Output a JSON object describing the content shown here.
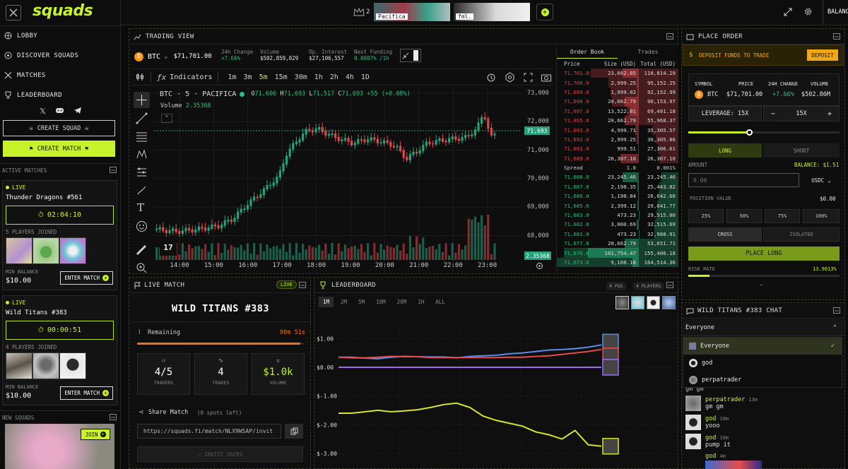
{
  "app": {
    "logo": "squads",
    "squad_count": "2",
    "balance_label": "BALANCE"
  },
  "topbar": {
    "thumbs": [
      {
        "label": "Pacifica"
      },
      {
        "label": "fml."
      }
    ]
  },
  "sidebar": {
    "nav": [
      {
        "label": "LOBBY",
        "icon": "globe-icon"
      },
      {
        "label": "DISCOVER SQUADS",
        "icon": "discover-icon"
      },
      {
        "label": "MATCHES",
        "icon": "swords-icon"
      },
      {
        "label": "LEADERBOARD",
        "icon": "trophy-icon"
      }
    ],
    "create_squad": "CREATE SQUAD",
    "create_match": "CREATE MATCH",
    "active_matches_title": "ACTIVE MATCHES",
    "matches": [
      {
        "status": "LIVE",
        "name": "Thunder Dragons #561",
        "timer": "02:04:10",
        "players": "5 PLAYERS JOINED",
        "min_balance_label": "MIN BALANCE",
        "min_balance": "$10.00",
        "enter": "ENTER MATCH"
      },
      {
        "status": "LIVE",
        "name": "Wild Titans #383",
        "timer": "00:00:51",
        "players": "4 PLAYERS JOINED",
        "min_balance_label": "MIN BALANCE",
        "min_balance": "$10.00",
        "enter": "ENTER MATCH"
      }
    ],
    "new_squads_title": "NEW SQUADS",
    "join": "JOIN"
  },
  "trading": {
    "title": "TRADING VIEW",
    "symbol": "BTC",
    "price": "$71,701.00",
    "stats": [
      {
        "label": "24h Change",
        "value": "+7.66%"
      },
      {
        "label": "Volume",
        "value": "$502,859,029"
      },
      {
        "label": "Op. Interest",
        "value": "$27,106,557"
      },
      {
        "label": "Next Funding",
        "value": "0.0007% /1h"
      }
    ],
    "indicators": "Indicators",
    "timeframes": [
      "1m",
      "3m",
      "5m",
      "15m",
      "30m",
      "1h",
      "2h",
      "4h",
      "1D"
    ],
    "active_tf": "5m",
    "legend": {
      "title": "BTC · 5 · PACIFICA",
      "o_label": "O",
      "o": "71,606",
      "h_label": "H",
      "h": "71,693",
      "l_label": "L",
      "l": "71,517",
      "c_label": "C",
      "c": "71,693",
      "chg": "+55 (+0.08%)",
      "volume_label": "Volume",
      "volume": "2.35368"
    },
    "price_axis": [
      "73,000",
      "72,000",
      "71,000",
      "70,000",
      "69,000",
      "68,000"
    ],
    "last_price": "71,693",
    "last_volume": "2.35368",
    "time_axis": [
      "14:00",
      "15:00",
      "16:00",
      "17:00",
      "18:00",
      "19:00",
      "20:00",
      "21:00",
      "22:00",
      "23:00"
    ]
  },
  "orderbook": {
    "tabs": [
      "Order Book",
      "Trades"
    ],
    "headers": [
      "Price",
      "Size (USD)",
      "Total (USD)"
    ],
    "asks": [
      [
        "71,701.0",
        "23,662.05",
        "118,814.29"
      ],
      [
        "71,700.0",
        "2,999.25",
        "95,152.25"
      ],
      [
        "71,699.0",
        "1,999.02",
        "92,152.99"
      ],
      [
        "71,698.0",
        "20,662.79",
        "90,153.97"
      ],
      [
        "71,697.0",
        "13,522.81",
        "69,491.18"
      ],
      [
        "71,695.0",
        "20,662.79",
        "55,968.37"
      ],
      [
        "71,693.0",
        "4,999.71",
        "35,305.57"
      ],
      [
        "71,692.0",
        "2,999.25",
        "30,305.86"
      ],
      [
        "71,691.0",
        "999.51",
        "27,306.61"
      ],
      [
        "71,689.0",
        "26,307.10",
        "26,307.10"
      ]
    ],
    "spread": [
      "Spread",
      "1.0",
      "0.001%"
    ],
    "bids": [
      [
        "71,688.0",
        "23,245.46",
        "23,245.46"
      ],
      [
        "71,687.0",
        "2,198.35",
        "25,443.82"
      ],
      [
        "71,686.0",
        "1,198.84",
        "26,642.66"
      ],
      [
        "71,685.0",
        "2,399.12",
        "29,041.77"
      ],
      [
        "71,683.0",
        "473.23",
        "29,515.00"
      ],
      [
        "71,682.0",
        "3,000.69",
        "32,515.69"
      ],
      [
        "71,681.0",
        "473.23",
        "32,988.91"
      ],
      [
        "71,677.0",
        "20,662.79",
        "53,651.71"
      ],
      [
        "71,676.0",
        "101,754.47",
        "155,406.18"
      ],
      [
        "71,673.0",
        "9,108.18",
        "164,514.36"
      ]
    ]
  },
  "order": {
    "title": "PLACE ORDER",
    "deposit_text": "DEPOSIT FUNDS TO TRADE",
    "deposit_btn": "DEPOSIT",
    "headers": [
      "SYMBOL",
      "PRICE",
      "24H CHANGE",
      "VOLUME"
    ],
    "row": [
      "BTC",
      "$71,701.00",
      "+7.66%",
      "$502.86M"
    ],
    "leverage_label": "LEVERAGE: 15X",
    "leverage": "15X",
    "leverage_fraction": 0.4,
    "long": "LONG",
    "short": "SHORT",
    "amount": "AMOUNT",
    "balance": "BALANCE: $1.51",
    "amount_placeholder": "0.00",
    "currency": "USDC",
    "position_value": "POSITION VALUE",
    "position_value_amount": "$0.00",
    "pcts": [
      "25%",
      "50%",
      "75%",
      "100%"
    ],
    "cross": "CROSS",
    "isolated": "ISOLATED",
    "place": "PLACE LONG",
    "risk_label": "RISK RATE",
    "risk": "13.9013%",
    "risk_fraction": 0.14
  },
  "live": {
    "title": "LIVE MATCH",
    "badge": "LIVE",
    "name": "WILD TITANS #383",
    "remaining": "Remaining",
    "remaining_time": "00m 51s",
    "remaining_fraction": 0.98,
    "stats": [
      {
        "value": "4/5",
        "label": "TRADERS"
      },
      {
        "value": "4",
        "label": "TRADES"
      },
      {
        "value": "$1.0k",
        "label": "VOLUME"
      }
    ],
    "share": "Share Match",
    "spots": "(0 spots left)",
    "url": "https://squads.fi/match/NLX9WSAP/invit",
    "invite": "INVITE USERS"
  },
  "leaderboard": {
    "title": "LEADERBOARD",
    "pos": "4 POS",
    "players": "4 PLAYERS",
    "tabs": [
      "1M",
      "2M",
      "5M",
      "10M",
      "20M",
      "1H",
      "ALL"
    ],
    "active": "1M",
    "yaxis": [
      "$1.00",
      "$0.00",
      "$-1.00",
      "$-2.00",
      "$-3.00"
    ]
  },
  "chart_data": {
    "type": "line",
    "x": [
      0,
      1,
      2,
      3,
      4,
      5,
      6,
      7,
      8,
      9,
      10,
      11,
      12,
      13,
      14,
      15,
      16,
      17,
      18,
      19,
      20
    ],
    "ylim": [
      -3.2,
      1.6
    ],
    "series": [
      {
        "values": [
          0.35,
          0.35,
          0.32,
          0.3,
          0.35,
          0.38,
          0.37,
          0.36,
          0.36,
          0.33,
          0.38,
          0.4,
          0.42,
          0.47,
          0.5,
          0.55,
          0.6,
          0.62,
          0.65,
          0.7,
          0.78
        ],
        "color": "#5b8ff0"
      },
      {
        "values": [
          0.35,
          0.33,
          0.33,
          0.35,
          0.38,
          0.37,
          0.37,
          0.34,
          0.34,
          0.34,
          0.34,
          0.34,
          0.34,
          0.35,
          0.35,
          0.38,
          0.4,
          0.45,
          0.5,
          0.55,
          0.62
        ],
        "color": "#e84c4c"
      },
      {
        "values": [
          0.0,
          0.0,
          0.0,
          0.0,
          0.0,
          0.0,
          0.0,
          0.0,
          0.0,
          0.0,
          0.0,
          0.0,
          0.0,
          0.0,
          0.0,
          0.0,
          0.0,
          0.0,
          0.0,
          0.0,
          0.0
        ],
        "color": "#9b6cf2"
      },
      {
        "values": [
          -1.6,
          -1.6,
          -1.55,
          -1.5,
          -1.55,
          -1.52,
          -1.48,
          -1.4,
          -1.3,
          -1.25,
          -1.4,
          -1.7,
          -1.85,
          -1.95,
          -2.05,
          -2.25,
          -2.35,
          -2.5,
          -2.2,
          -2.7,
          -2.75
        ],
        "color": "#d5e628"
      }
    ]
  },
  "chat": {
    "title": "WILD TITANS #383 CHAT",
    "filter": "Everyone",
    "options": [
      "Everyone",
      "god",
      "perpatrader"
    ],
    "messages": [
      {
        "user": "",
        "time": "",
        "text": "gm gm"
      },
      {
        "user": "perpatrader",
        "time": "13m",
        "text": "gm gm"
      },
      {
        "user": "god",
        "time": "10m",
        "text": "yooo"
      },
      {
        "user": "god",
        "time": "10m",
        "text": "pump it"
      },
      {
        "user": "god",
        "time": "4m",
        "text": ""
      }
    ]
  },
  "colors": {
    "accent": "#c8f22a",
    "up": "#26c281",
    "down": "#e0454c",
    "orange": "#f0a81a"
  }
}
